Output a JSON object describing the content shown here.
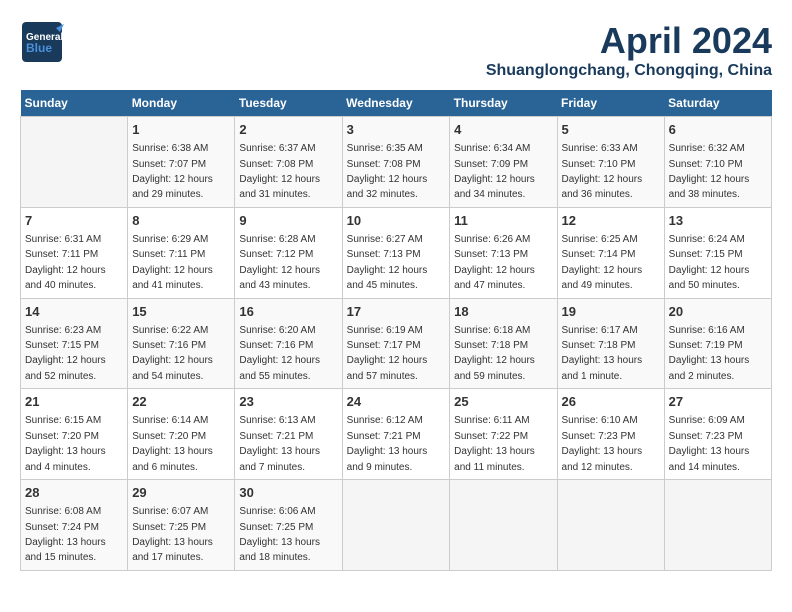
{
  "header": {
    "logo_general": "General",
    "logo_blue": "Blue",
    "month": "April 2024",
    "location": "Shuanglongchang, Chongqing, China"
  },
  "days_of_week": [
    "Sunday",
    "Monday",
    "Tuesday",
    "Wednesday",
    "Thursday",
    "Friday",
    "Saturday"
  ],
  "weeks": [
    [
      {
        "day": "",
        "sunrise": "",
        "sunset": "",
        "daylight": ""
      },
      {
        "day": "1",
        "sunrise": "Sunrise: 6:38 AM",
        "sunset": "Sunset: 7:07 PM",
        "daylight": "Daylight: 12 hours and 29 minutes."
      },
      {
        "day": "2",
        "sunrise": "Sunrise: 6:37 AM",
        "sunset": "Sunset: 7:08 PM",
        "daylight": "Daylight: 12 hours and 31 minutes."
      },
      {
        "day": "3",
        "sunrise": "Sunrise: 6:35 AM",
        "sunset": "Sunset: 7:08 PM",
        "daylight": "Daylight: 12 hours and 32 minutes."
      },
      {
        "day": "4",
        "sunrise": "Sunrise: 6:34 AM",
        "sunset": "Sunset: 7:09 PM",
        "daylight": "Daylight: 12 hours and 34 minutes."
      },
      {
        "day": "5",
        "sunrise": "Sunrise: 6:33 AM",
        "sunset": "Sunset: 7:10 PM",
        "daylight": "Daylight: 12 hours and 36 minutes."
      },
      {
        "day": "6",
        "sunrise": "Sunrise: 6:32 AM",
        "sunset": "Sunset: 7:10 PM",
        "daylight": "Daylight: 12 hours and 38 minutes."
      }
    ],
    [
      {
        "day": "7",
        "sunrise": "Sunrise: 6:31 AM",
        "sunset": "Sunset: 7:11 PM",
        "daylight": "Daylight: 12 hours and 40 minutes."
      },
      {
        "day": "8",
        "sunrise": "Sunrise: 6:29 AM",
        "sunset": "Sunset: 7:11 PM",
        "daylight": "Daylight: 12 hours and 41 minutes."
      },
      {
        "day": "9",
        "sunrise": "Sunrise: 6:28 AM",
        "sunset": "Sunset: 7:12 PM",
        "daylight": "Daylight: 12 hours and 43 minutes."
      },
      {
        "day": "10",
        "sunrise": "Sunrise: 6:27 AM",
        "sunset": "Sunset: 7:13 PM",
        "daylight": "Daylight: 12 hours and 45 minutes."
      },
      {
        "day": "11",
        "sunrise": "Sunrise: 6:26 AM",
        "sunset": "Sunset: 7:13 PM",
        "daylight": "Daylight: 12 hours and 47 minutes."
      },
      {
        "day": "12",
        "sunrise": "Sunrise: 6:25 AM",
        "sunset": "Sunset: 7:14 PM",
        "daylight": "Daylight: 12 hours and 49 minutes."
      },
      {
        "day": "13",
        "sunrise": "Sunrise: 6:24 AM",
        "sunset": "Sunset: 7:15 PM",
        "daylight": "Daylight: 12 hours and 50 minutes."
      }
    ],
    [
      {
        "day": "14",
        "sunrise": "Sunrise: 6:23 AM",
        "sunset": "Sunset: 7:15 PM",
        "daylight": "Daylight: 12 hours and 52 minutes."
      },
      {
        "day": "15",
        "sunrise": "Sunrise: 6:22 AM",
        "sunset": "Sunset: 7:16 PM",
        "daylight": "Daylight: 12 hours and 54 minutes."
      },
      {
        "day": "16",
        "sunrise": "Sunrise: 6:20 AM",
        "sunset": "Sunset: 7:16 PM",
        "daylight": "Daylight: 12 hours and 55 minutes."
      },
      {
        "day": "17",
        "sunrise": "Sunrise: 6:19 AM",
        "sunset": "Sunset: 7:17 PM",
        "daylight": "Daylight: 12 hours and 57 minutes."
      },
      {
        "day": "18",
        "sunrise": "Sunrise: 6:18 AM",
        "sunset": "Sunset: 7:18 PM",
        "daylight": "Daylight: 12 hours and 59 minutes."
      },
      {
        "day": "19",
        "sunrise": "Sunrise: 6:17 AM",
        "sunset": "Sunset: 7:18 PM",
        "daylight": "Daylight: 13 hours and 1 minute."
      },
      {
        "day": "20",
        "sunrise": "Sunrise: 6:16 AM",
        "sunset": "Sunset: 7:19 PM",
        "daylight": "Daylight: 13 hours and 2 minutes."
      }
    ],
    [
      {
        "day": "21",
        "sunrise": "Sunrise: 6:15 AM",
        "sunset": "Sunset: 7:20 PM",
        "daylight": "Daylight: 13 hours and 4 minutes."
      },
      {
        "day": "22",
        "sunrise": "Sunrise: 6:14 AM",
        "sunset": "Sunset: 7:20 PM",
        "daylight": "Daylight: 13 hours and 6 minutes."
      },
      {
        "day": "23",
        "sunrise": "Sunrise: 6:13 AM",
        "sunset": "Sunset: 7:21 PM",
        "daylight": "Daylight: 13 hours and 7 minutes."
      },
      {
        "day": "24",
        "sunrise": "Sunrise: 6:12 AM",
        "sunset": "Sunset: 7:21 PM",
        "daylight": "Daylight: 13 hours and 9 minutes."
      },
      {
        "day": "25",
        "sunrise": "Sunrise: 6:11 AM",
        "sunset": "Sunset: 7:22 PM",
        "daylight": "Daylight: 13 hours and 11 minutes."
      },
      {
        "day": "26",
        "sunrise": "Sunrise: 6:10 AM",
        "sunset": "Sunset: 7:23 PM",
        "daylight": "Daylight: 13 hours and 12 minutes."
      },
      {
        "day": "27",
        "sunrise": "Sunrise: 6:09 AM",
        "sunset": "Sunset: 7:23 PM",
        "daylight": "Daylight: 13 hours and 14 minutes."
      }
    ],
    [
      {
        "day": "28",
        "sunrise": "Sunrise: 6:08 AM",
        "sunset": "Sunset: 7:24 PM",
        "daylight": "Daylight: 13 hours and 15 minutes."
      },
      {
        "day": "29",
        "sunrise": "Sunrise: 6:07 AM",
        "sunset": "Sunset: 7:25 PM",
        "daylight": "Daylight: 13 hours and 17 minutes."
      },
      {
        "day": "30",
        "sunrise": "Sunrise: 6:06 AM",
        "sunset": "Sunset: 7:25 PM",
        "daylight": "Daylight: 13 hours and 18 minutes."
      },
      {
        "day": "",
        "sunrise": "",
        "sunset": "",
        "daylight": ""
      },
      {
        "day": "",
        "sunrise": "",
        "sunset": "",
        "daylight": ""
      },
      {
        "day": "",
        "sunrise": "",
        "sunset": "",
        "daylight": ""
      },
      {
        "day": "",
        "sunrise": "",
        "sunset": "",
        "daylight": ""
      }
    ]
  ]
}
